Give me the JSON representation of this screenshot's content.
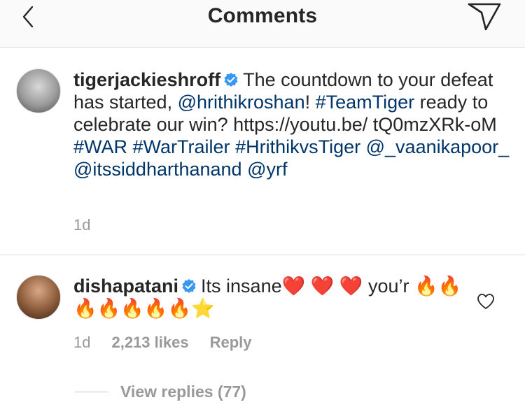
{
  "header": {
    "title": "Comments"
  },
  "post": {
    "username": "tigerjackieshroff",
    "text_parts": [
      {
        "t": "The countdown to your defeat has started, ",
        "link": false
      },
      {
        "t": "@hrithikroshan",
        "link": true
      },
      {
        "t": "! ",
        "link": false
      },
      {
        "t": "#TeamTiger",
        "link": true
      },
      {
        "t": " ready to celebrate our win? https://youtu.be/ tQ0mzXRk-oM ",
        "link": false
      },
      {
        "t": "#WAR",
        "link": true
      },
      {
        "t": " ",
        "link": false
      },
      {
        "t": "#WarTrailer",
        "link": true
      },
      {
        "t": " ",
        "link": false
      },
      {
        "t": "#HrithikvsTiger",
        "link": true
      },
      {
        "t": " ",
        "link": false
      },
      {
        "t": "@_vaanikapoor_",
        "link": true
      },
      {
        "t": " ",
        "link": false
      },
      {
        "t": "@itssiddharthanand",
        "link": true
      },
      {
        "t": " ",
        "link": false
      },
      {
        "t": "@yrf",
        "link": true
      }
    ],
    "time": "1d"
  },
  "comment": {
    "username": "dishapatani",
    "text": "Its insane❤️ ❤️ ❤️ you’r 🔥🔥🔥🔥🔥🔥🔥⭐",
    "time": "1d",
    "likes": "2,213 likes",
    "reply_label": "Reply"
  },
  "replies": {
    "label": "View replies (77)"
  },
  "colors": {
    "link": "#003569",
    "verified": "#3897f0",
    "meta": "#999999"
  },
  "icons": {
    "back": "chevron-left-icon",
    "send": "paper-plane-icon",
    "verified": "verified-badge-icon",
    "like": "heart-outline-icon"
  }
}
